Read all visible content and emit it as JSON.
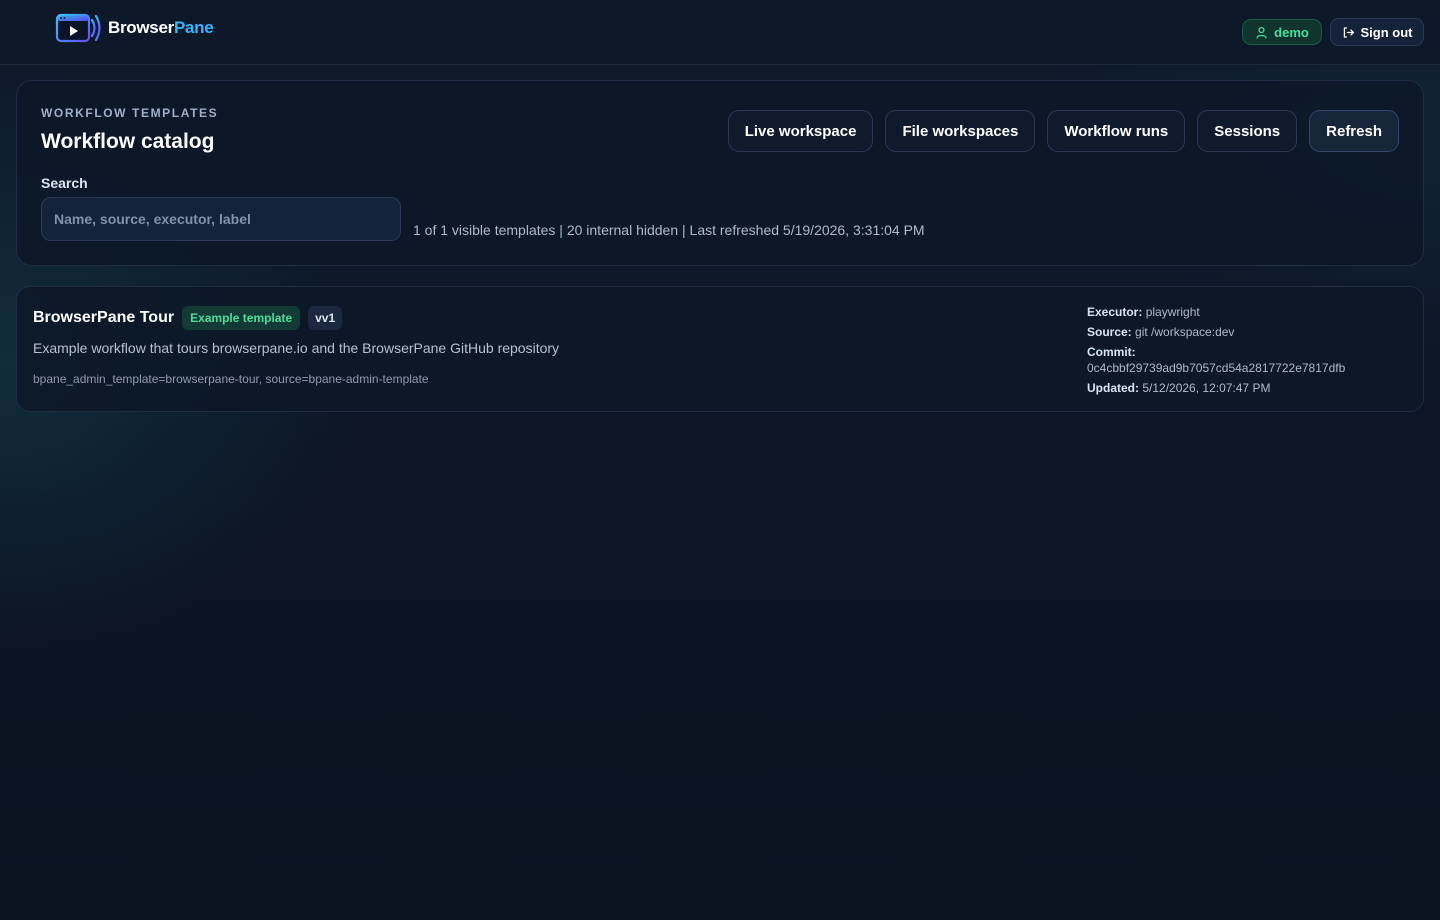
{
  "header": {
    "brand_part1": "Browser",
    "brand_part2": "Pane",
    "user_label": "demo",
    "signout_label": "Sign out",
    "icons": {
      "user": "user-icon",
      "signout": "sign-out-icon",
      "logo": "browserpane-logo-icon"
    }
  },
  "catalog": {
    "eyebrow": "WORKFLOW TEMPLATES",
    "title": "Workflow catalog",
    "nav": [
      {
        "label": "Live workspace"
      },
      {
        "label": "File workspaces"
      },
      {
        "label": "Workflow runs"
      },
      {
        "label": "Sessions"
      },
      {
        "label": "Refresh"
      }
    ],
    "search": {
      "label": "Search",
      "placeholder": "Name, source, executor, label",
      "value": ""
    },
    "status": "1 of 1 visible templates | 20 internal hidden | Last refreshed 5/19/2026, 3:31:04 PM"
  },
  "templates": [
    {
      "name": "BrowserPane Tour",
      "badge": "Example template",
      "version": "vv1",
      "description": "Example workflow that tours browserpane.io and the BrowserPane GitHub repository",
      "labels": "bpane_admin_template=browserpane-tour, source=bpane-admin-template",
      "executor_key": "Executor:",
      "executor": "playwright",
      "source_key": "Source:",
      "source": "git /workspace:dev",
      "commit_key": "Commit:",
      "commit": "0c4cbbf29739ad9b7057cd54a2817722e7817dfb",
      "updated_key": "Updated:",
      "updated": "5/12/2026, 12:07:47 PM"
    }
  ],
  "colors": {
    "background": "#0c1626",
    "accent_green": "#4ade9a",
    "accent_blue": "#33b5ff"
  }
}
